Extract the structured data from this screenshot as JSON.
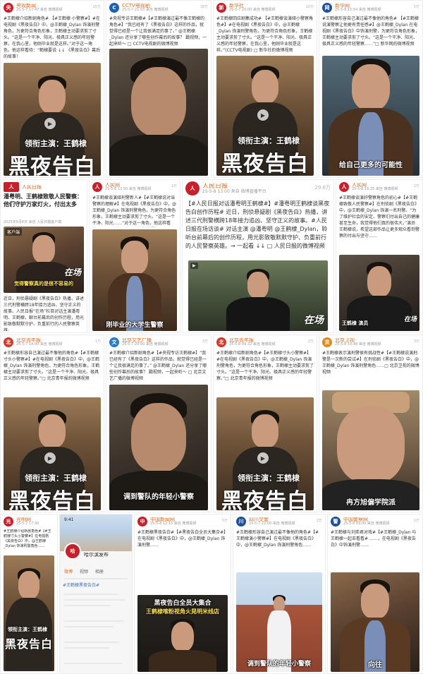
{
  "cards": {
    "c1": {
      "account": "央视新闻",
      "time": "25-5-7 17:47 来自 微博视频",
      "stats": "15万",
      "body": "#王鹤棣介绍新剧角色# 【#王鹤棣 小警察#】#在电视剧《黑夜告白》中，@王鹤棣_Dylan 饰演刑警角色，为更符合角色形象，王鹤棣主动要求剪了寸头。“这是一个干净、阳光、极具正义感的年轻警察，在我心里，他刚毕业就是这样。”对于这一角色，他这样看待：“鹤棣要说 ↓↓ 《黑夜告白》幕后的故事！",
      "source": "□ 央视新闻的微博视频",
      "poster_star": "领衔主演：王鹤棣",
      "poster_title": "黑夜告白"
    },
    "c2": {
      "account": "CCTV电视剧",
      "time": "25-5-7 21:03 来自 微博视频",
      "stats": "18万",
      "body": "#央视专访王鹤棣#【#王鹤棣演过最不像王鹤棣的角色#】“我已经有了《黑夜告白》这样的作品，就觉得已经是一个让我很满足的事了。” @王鹤棣_Dylan 还分享了哪些创作幕后的故事？ 戳视频，一起来听～ □ CCTV电视剧的微博视频"
    },
    "c3": {
      "account": "新华社",
      "time": "25-5-7 20:00 来自 微博视频",
      "stats": "10万",
      "body": "#王鹤棣回应剧集成功# 【#王鹤棣谈演绎小警察角色#】#在电视剧《黑夜告白》中，@王鹤棣_Dylan 饰演刑警角色，为更符合角色形象，王鹤棣主动要求剪了寸头。“这是一个干净、阳光、极具正义感的年轻警察，在我心里，他刚毕业就是这样。”(CCTV电视剧) □ 新华社的微博视频",
      "poster_star": "领衔主演：王鹤棣",
      "poster_title": "黑夜告白"
    },
    "c4": {
      "account": "新华网",
      "time": "25-5-8 15:54 来自 微博视频",
      "stats": "5万",
      "body": "#王鹤棣形容自己演过最不像他的角色# 【#王鹤棣说演警察让他更有责任感#】@王鹤棣_Dylan 在电视剧《黑夜告白》中饰演刑警，为更符合角色形象，王鹤棣主动要求剪了寸头。“这是一个干净、阳光、极具正义感的年轻警察……”□ 新华网的微博视频",
      "caption": "给自己更多的可能性"
    },
    "c5": {
      "account": "人民日报",
      "headline": "潘粤明、王鹤棣致敬人民警察：他们守护万家灯火，付出太多",
      "time": "2025年5月8日 来自 人民日报客户端",
      "app_badge": "客户端",
      "body": "近日，刑侦悬疑剧《黑夜告白》热播，讲述三代刑警横跨18年接力追凶、坚守正义的故事。人民日报“在场”栏目对话主演潘粤明、王鹤棣，聊台前幕后的创作历程，用光影致敬默默守护、负重前行的人民警察英雄。",
      "caption": "觉得警察真的是很不容易的",
      "zaichang": "在场"
    },
    "c6": {
      "account": "人民网",
      "time": "25-5-8 13:50 来自 微博视频",
      "stats": "1万",
      "body": "#王鹤棣谈演绎刑警新人#【#王鹤棣说对当警察的理解#】在电视剧《黑夜告白》中，@王鹤棣_Dylan 饰演刑警角色，为更符合角色形象，王鹤棣主动要求剪了寸头。“这是一个干净、阳光……”对于这一角色，他这样看待……#王鹤棣#人民网的微博视频",
      "caption": "刚毕业的大学生警察"
    },
    "c7": {
      "account": "人民日报",
      "time": "25-5-8 13:00 来自 微博直播平台",
      "stats": "29.6万",
      "body": "【#人民日报对话潘粤明王鹤棣#】#潘粤明王鹤棣谈黑夜告白创作历程# 近日，刑侦悬疑剧《黑夜告白》热播，讲述三代刑警横跨18年接力追凶、坚守正义的故事。#人民日报在场访谈# 对话主演 @潘粤明 @王鹤棣_Dylan，聆听台前幕后的创作历程，用光影致敬默默守护、负重前行的人民警察英雄。→ 一起看 ↓↓ □ 人民日报的微博视频",
      "zaichang": "在场"
    },
    "c8": {
      "account": "人民网",
      "time": "25-5-8 16:25 来自 微博视频",
      "stats": "2万",
      "body": "#王鹤棣谈演好警察角色的初心#【#王鹤棣致敬人民警察#】在刑侦剧《黑夜告白》中，@王鹤棣_Dylan 饰演一名刑警。“为了维护社会的安定，警察们付出自己的健康甚至生命，我觉得他们真的很伟大。”演员王鹤棣说，希望这部作品让更多观众看到警察的付出与坚守……",
      "caption": "王鹤棣 演员"
    },
    "c9": {
      "account": "北京青年报",
      "time": "25-5-7 18:00 来自 微博视频",
      "stats": "1万",
      "body": "#王鹤棣形容自己演过最不像他的角色#【#王鹤棣寸头小警察#】#在电视剧《黑夜告白》中，@王鹤棣_Dylan 饰演刑警角色，为更符合角色形象，王鹤棣主动要求剪了寸头。“这是一个干净、阳光、极具正义感的年轻警察。”□ 北京青年报的微博视频",
      "poster_star": "领衔主演：王鹤棣",
      "poster_title": "黑夜告白"
    },
    "c10": {
      "account": "北京文艺广播",
      "time": "25-5-7 20:00 来自 微博视频",
      "stats": "3万",
      "body": "#王鹤棣介绍新剧角色#【#央视专访王鹤棣#】“我已经有了《黑夜告白》这样的作品，就觉得已经是一个让我很满足的事了。” @王鹤棣_Dylan 还分享了哪些创作幕后的故事？ 戳视频，一起来听～ □ 北京文艺广播的微博视频",
      "caption": "调到警队的年轻小警察"
    },
    "c11": {
      "account": "北京青年报",
      "time": "25-5-8 09:32 来自 微博视频",
      "stats": "2万",
      "body": "#王鹤棣介绍新剧角色#【#王鹤棣寸头小警察#】#在电视剧《黑夜告白》中，@王鹤棣_Dylan 饰演刑警角色，为更符合角色形象，王鹤棣主动要求剪了寸头。“这是一个干净、阳光、极具正义感的年轻警察。”□ 北京青年报的微博视频",
      "poster_star": "领衔主演：王鹤棣",
      "poster_title": "黑夜告白"
    },
    "c12": {
      "account": "北京卫视",
      "time": "25-5-8 10:48 来自 微博视频",
      "stats": "3万",
      "body": "#王鹤棣表示演刑警很有挑战性#【#王鹤棣说演刑警是一次新的尝试#】在刑侦剧《黑夜告白》中，@王鹤棣_Dylan 饰演刑警角色……□ 北京卫视的微博视频",
      "caption": "冉方旭偏学院派"
    },
    "c13": {
      "account": "光明网",
      "time": "25-5-7 17:30",
      "stats": "8千",
      "body": "#王鹤棣介绍新剧角色#【#王鹤棣寸头小警察#】在电视剧《黑夜告白》中，@王鹤棣_Dylan 饰演刑警角色……",
      "poster_star": "领衔主演：王鹤棣",
      "poster_title": "黑夜告白"
    },
    "c14": {
      "account": "哈尔滨发布",
      "status_time": "9:41",
      "tabs": [
        "微博",
        "视频",
        "相册"
      ],
      "body": "#王鹤棣黑夜告白#"
    },
    "c15": {
      "account": "中国新闻网",
      "time": "25-5-8 12:15 来自 微博视频",
      "stats": "5万",
      "body": "#王鹤棣黑夜告白#【#黑夜告白全员大集合#】在电视剧《黑夜告白》中，@王鹤棣_Dylan 饰演刑警……",
      "banner": "黑夜告白全员大集合",
      "banner2": "王鹤棣嗦粉视角火晃明米线店"
    },
    "c16": {
      "account": "四川交警",
      "time": "25-5-7 22:00 来自 微博视频",
      "stats": "2万",
      "body": "#王鹤棣形容自己演过最不像他的角色#【#王鹤棣演小警察#】在电视剧《黑夜告白》中，@王鹤棣_Dylan 饰演刑警角色……",
      "caption": "调到警队的年轻小警察"
    },
    "c17": {
      "account": "中国警察网",
      "time": "25-5-8 09:00 来自 微博视频",
      "stats": "1万",
      "body": "#王鹤棣与刘奕君对戏#【#王鹤棣_Dylan 与王鹤棣一起去看看# ……，在电视剧《黑夜告白》中饰演刑警……",
      "caption": "向往"
    }
  }
}
